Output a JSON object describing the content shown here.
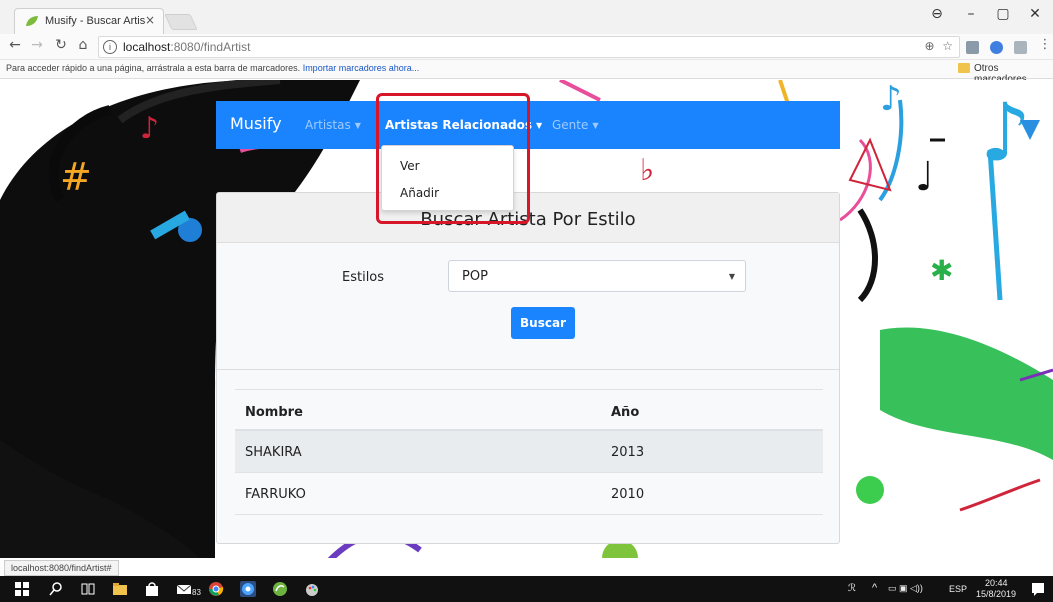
{
  "browser": {
    "tab_title": "Musify - Buscar Artista P",
    "tab_close": "×",
    "url_host": "localhost",
    "url_path": ":8080/findArtist",
    "info_glyph": "i",
    "bookmarks_text": "Para acceder rápido a una página, arrástrala a esta barra de marcadores.",
    "bookmarks_link": "Importar marcadores ahora...",
    "other_bookmarks": "Otros marcadores",
    "zoom_glyph": "⊕",
    "star_glyph": "☆",
    "menu_glyph": "⋮"
  },
  "window_controls": {
    "profile": "⊖",
    "minimize": "–",
    "maximize": "▢",
    "close": "✕"
  },
  "navbar": {
    "brand": "Musify",
    "items": [
      {
        "label": "Artistas",
        "state": "dim"
      },
      {
        "label": "Artistas Relacionados",
        "state": "active"
      },
      {
        "label": "Gente",
        "state": "dim"
      }
    ],
    "dropdown": [
      "Ver",
      "Añadir"
    ]
  },
  "card": {
    "title": "Buscar Artista Por Estilo",
    "form_label": "Estilos",
    "select_value": "POP",
    "button_label": "Buscar",
    "table": {
      "headers": [
        "Nombre",
        "Año"
      ],
      "rows": [
        [
          "SHAKIRA",
          "2013"
        ],
        [
          "FARRUKO",
          "2010"
        ]
      ]
    }
  },
  "status_url": "localhost:8080/findArtist#",
  "taskbar": {
    "language": "ESP",
    "time": "20:44",
    "date": "15/8/2019",
    "store_badge": "83"
  },
  "colors": {
    "navbar": "#1a84ff",
    "highlight": "#d8162a",
    "button": "#1a84ff"
  }
}
